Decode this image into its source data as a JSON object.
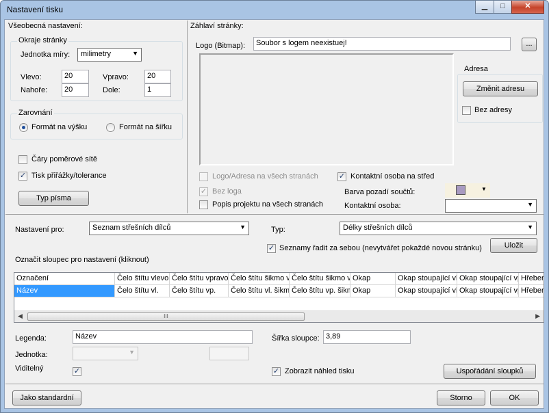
{
  "window": {
    "title": "Nastavení tisku",
    "minimize_glyph": "▁",
    "maximize_glyph": "□",
    "close_glyph": "✕"
  },
  "general": {
    "title": "Všeobecná nastavení:",
    "margins": {
      "title": "Okraje stránky",
      "unit_label": "Jednotka míry:",
      "unit_value": "milimetry",
      "left_label": "Vlevo:",
      "left_value": "20",
      "right_label": "Vpravo:",
      "right_value": "20",
      "top_label": "Nahoře:",
      "top_value": "20",
      "bottom_label": "Dole:",
      "bottom_value": "1"
    },
    "alignment": {
      "title": "Zarovnání",
      "portrait_label": "Formát na výšku",
      "landscape_label": "Formát na šířku",
      "selected": "portrait"
    },
    "grid_lines_label": "Čáry poměrové sítě",
    "grid_lines_checked": false,
    "print_tolerance_label": "Tisk přiřážky/tolerance",
    "print_tolerance_checked": true,
    "font_button": "Typ písma"
  },
  "header": {
    "title": "Záhlaví stránky:",
    "logo_label": "Logo (Bitmap):",
    "logo_value": "Soubor s logem neexistuej!",
    "browse_button": "...",
    "address": {
      "title": "Adresa",
      "change_button": "Změnit adresu",
      "no_address_label": "Bez adresy",
      "no_address_checked": false
    },
    "logo_all_pages_label": "Logo/Adresa na všech stranách",
    "no_logo_label": "Bez loga",
    "project_desc_label": "Popis projektu na všech stranách",
    "contact_center_label": "Kontaktní osoba na střed",
    "contact_center_checked": true,
    "sum_bg_label": "Barva pozadí součtů:",
    "sum_bg_color": "#a89ac0",
    "contact_label": "Kontaktní osoba:",
    "contact_value": ""
  },
  "settings": {
    "for_label": "Nastavení pro:",
    "for_value": "Seznam střešních dílců",
    "type_label": "Typ:",
    "type_value": "Délky střešních dílců",
    "sequential_label": "Seznamy řadit za sebou (nevytvářet pokaždé novou stránku)",
    "sequential_checked": true,
    "save_button": "Uložit",
    "mark_column_label": "Označit sloupec pro nastavení (kliknout)"
  },
  "table": {
    "columns": [
      "Označení",
      "Čelo štítu vlevo",
      "Čelo štítu vpravo",
      "Čelo štítu šikmo vlevo",
      "Čelo štítu šikmo vpravo",
      "Okap",
      "Okap stoupající vlevo",
      "Okap stoupající vpravo",
      "Hřeben"
    ],
    "rows": [
      [
        "Název",
        "Čelo štítu vl.",
        "Čelo štítu vp.",
        "Čelo štítu vl. šikmo",
        "Čelo štítu vp. šikmo",
        "Okap",
        "Okap stoupající vl.",
        "Okap stoupající vp.",
        "Hřeben"
      ]
    ],
    "scroll_grip": "III",
    "scroll_left": "◀",
    "scroll_right": "▶"
  },
  "column_props": {
    "legend_label": "Legenda:",
    "legend_value": "Název",
    "width_label": "Šířka sloupce:",
    "width_value": "3,89",
    "unit_label": "Jednotka:",
    "unit_value": "",
    "visible_label": "Viditelný",
    "visible_checked": true,
    "preview_label": "Zobrazit náhled tisku",
    "preview_checked": true,
    "arrange_button": "Uspořádání sloupků"
  },
  "footer": {
    "default_button": "Jako standardní",
    "cancel_button": "Storno",
    "ok_button": "OK"
  }
}
